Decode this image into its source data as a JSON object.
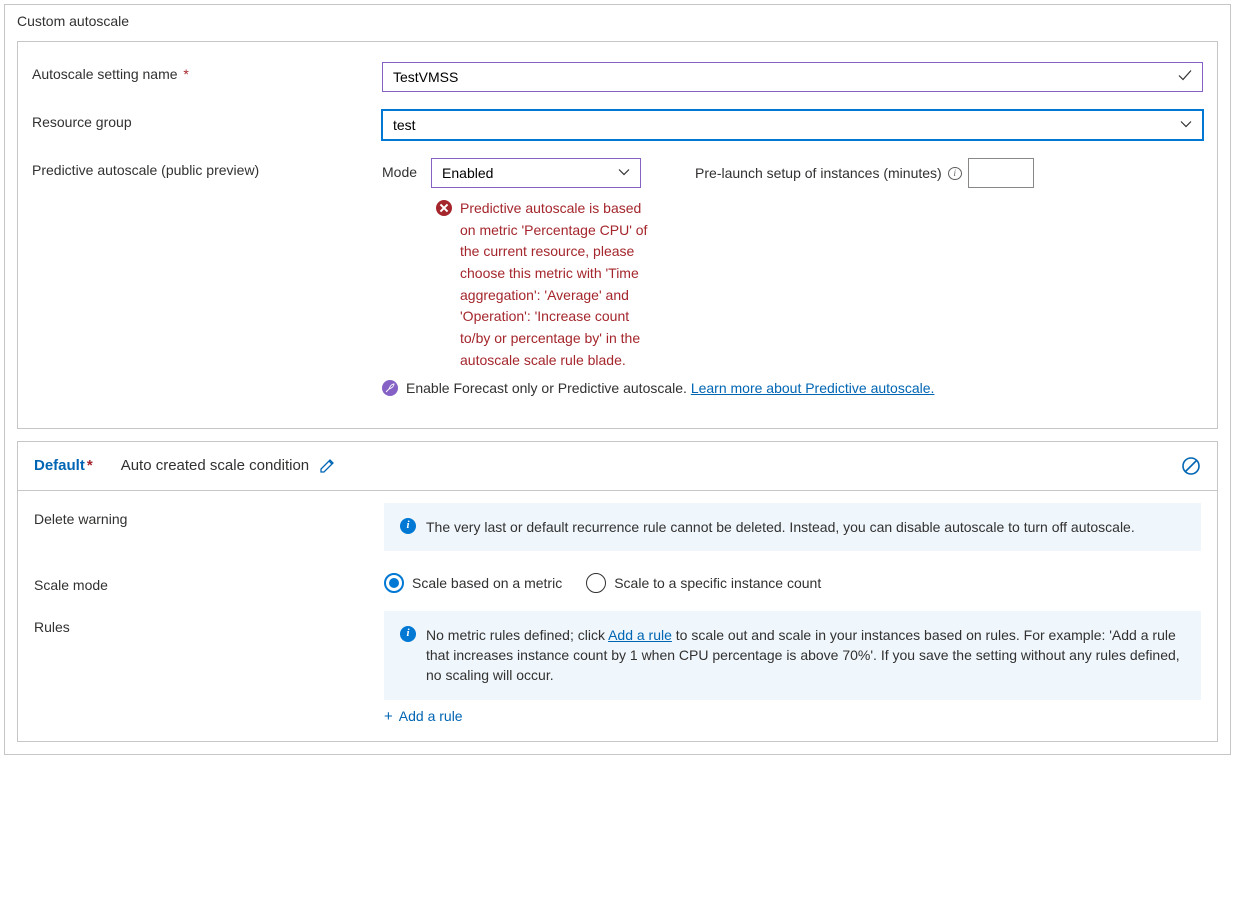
{
  "panel": {
    "title": "Custom autoscale"
  },
  "form": {
    "settingName": {
      "label": "Autoscale setting name",
      "value": "TestVMSS"
    },
    "resourceGroup": {
      "label": "Resource group",
      "value": "test"
    },
    "predictive": {
      "label": "Predictive autoscale (public preview)",
      "modeLabel": "Mode",
      "modeValue": "Enabled",
      "prelaunchLabel": "Pre-launch setup of instances (minutes)",
      "prelaunchValue": "",
      "error": "Predictive autoscale is based on metric 'Percentage CPU' of the current resource, please choose this metric with 'Time aggregation': 'Average' and 'Operation': 'Increase count to/by or percentage by' in the autoscale scale rule blade.",
      "forecastText": "Enable Forecast only or Predictive autoscale. ",
      "forecastLink": "Learn more about Predictive autoscale."
    }
  },
  "condition": {
    "defaultLabel": "Default",
    "name": "Auto created scale condition",
    "deleteWarning": {
      "label": "Delete warning",
      "text": "The very last or default recurrence rule cannot be deleted. Instead, you can disable autoscale to turn off autoscale."
    },
    "scaleMode": {
      "label": "Scale mode",
      "optionMetric": "Scale based on a metric",
      "optionCount": "Scale to a specific instance count"
    },
    "rules": {
      "label": "Rules",
      "infoPrefix": "No metric rules defined; click ",
      "infoLink": "Add a rule",
      "infoSuffix": " to scale out and scale in your instances based on rules. For example: 'Add a rule that increases instance count by 1 when CPU percentage is above 70%'. If you save the setting without any rules defined, no scaling will occur.",
      "addRule": "Add a rule"
    }
  }
}
